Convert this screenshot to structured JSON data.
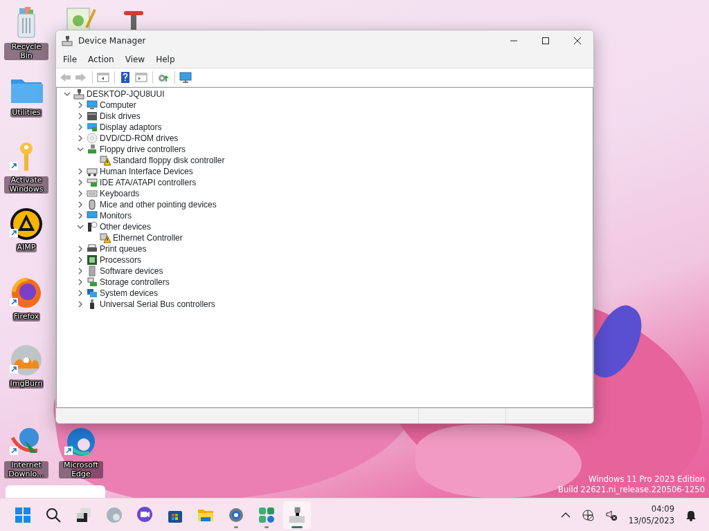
{
  "desktop_icons": [
    {
      "label": "Recycle Bin",
      "shortcut": false
    },
    {
      "label": "Utilities",
      "shortcut": false
    },
    {
      "label": "Activate Windows",
      "shortcut": true
    },
    {
      "label": "AIMP",
      "shortcut": true
    },
    {
      "label": "Firefox",
      "shortcut": true
    },
    {
      "label": "ImgBurn",
      "shortcut": true
    },
    {
      "label": "Internet Downlo...",
      "shortcut": true
    },
    {
      "label": "Microsoft Edge",
      "shortcut": true
    }
  ],
  "window": {
    "title": "Device Manager",
    "menu": [
      "File",
      "Action",
      "View",
      "Help"
    ],
    "toolbar": [
      {
        "kind": "back",
        "disabled": true
      },
      {
        "kind": "forward",
        "disabled": true
      },
      {
        "kind": "separator"
      },
      {
        "kind": "console-tree",
        "disabled": false
      },
      {
        "kind": "separator"
      },
      {
        "kind": "help",
        "disabled": false
      },
      {
        "kind": "action-pane",
        "disabled": false
      },
      {
        "kind": "separator"
      },
      {
        "kind": "update-driver",
        "disabled": false
      },
      {
        "kind": "separator"
      },
      {
        "kind": "scan",
        "disabled": false
      }
    ],
    "tree": {
      "label": "DESKTOP-JQU8UUI",
      "expanded": true,
      "children": [
        {
          "label": "Computer",
          "expanded": false
        },
        {
          "label": "Disk drives",
          "expanded": false
        },
        {
          "label": "Display adaptors",
          "expanded": false
        },
        {
          "label": "DVD/CD-ROM drives",
          "expanded": false
        },
        {
          "label": "Floppy drive controllers",
          "expanded": true,
          "children": [
            {
              "label": "Standard floppy disk controller",
              "warning": true
            }
          ]
        },
        {
          "label": "Human Interface Devices",
          "expanded": false
        },
        {
          "label": "IDE ATA/ATAPI controllers",
          "expanded": false
        },
        {
          "label": "Keyboards",
          "expanded": false
        },
        {
          "label": "Mice and other pointing devices",
          "expanded": false
        },
        {
          "label": "Monitors",
          "expanded": false
        },
        {
          "label": "Other devices",
          "expanded": true,
          "children": [
            {
              "label": "Ethernet Controller",
              "warning": true
            }
          ]
        },
        {
          "label": "Print queues",
          "expanded": false
        },
        {
          "label": "Processors",
          "expanded": false
        },
        {
          "label": "Software devices",
          "expanded": false
        },
        {
          "label": "Storage controllers",
          "expanded": false
        },
        {
          "label": "System devices",
          "expanded": false
        },
        {
          "label": "Universal Serial Bus controllers",
          "expanded": false
        }
      ]
    }
  },
  "watermark_lines": [
    "Windows 11 Pro 2023 Edition",
    "Build 22621.ni_release.220506-1250"
  ],
  "taskbar": {
    "apps": [
      {
        "kind": "start",
        "running": false,
        "active": false
      },
      {
        "kind": "search",
        "running": false,
        "active": false
      },
      {
        "kind": "task-view",
        "running": false,
        "active": false
      },
      {
        "kind": "browser",
        "running": false,
        "active": false
      },
      {
        "kind": "meet",
        "running": false,
        "active": false
      },
      {
        "kind": "store",
        "running": false,
        "active": false
      },
      {
        "kind": "folder",
        "running": false,
        "active": false
      },
      {
        "kind": "settings",
        "running": true,
        "active": false
      },
      {
        "kind": "widgets",
        "running": true,
        "active": false
      },
      {
        "kind": "device-manager",
        "running": true,
        "active": true
      }
    ],
    "time": "04:09",
    "date": "13/05/2023"
  }
}
